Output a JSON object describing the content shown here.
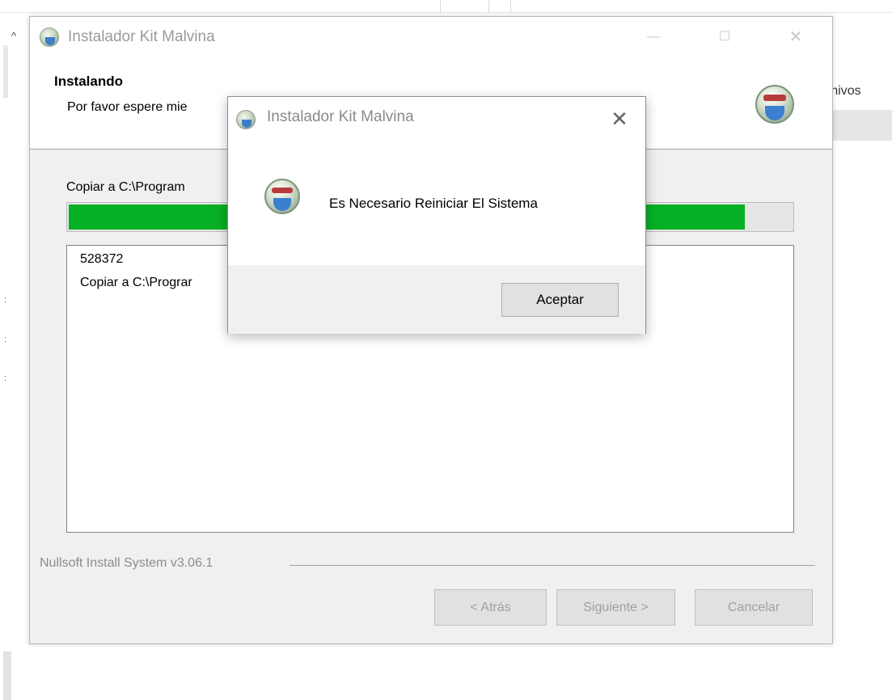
{
  "background": {
    "right_text": "rchivos",
    "dots": [
      ":",
      ":",
      ":"
    ]
  },
  "installer": {
    "window_title": "Instalador Kit Malvina",
    "controls": {
      "minimize": "—",
      "maximize": "☐",
      "close": "✕"
    },
    "header": {
      "title": "Instalando",
      "subtitle": "Por favor espere mie"
    },
    "detail_label": "Copiar a C:\\Program",
    "progress": 0.935,
    "log_lines": [
      "528372",
      "Copiar a C:\\Prograr"
    ],
    "branding": "Nullsoft Install System v3.06.1",
    "buttons": {
      "back": "< Atrás",
      "next": "Siguiente >",
      "cancel": "Cancelar"
    }
  },
  "message_box": {
    "title": "Instalador Kit Malvina",
    "close": "✕",
    "message": "Es Necesario Reiniciar El Sistema",
    "ok_label": "Aceptar"
  },
  "colors": {
    "progress_fill": "#06b025",
    "window_bg": "#f0f0f0"
  }
}
